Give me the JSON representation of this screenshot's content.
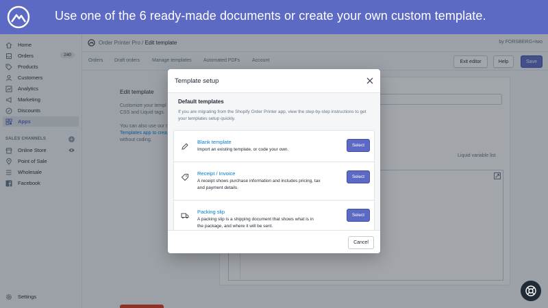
{
  "banner": {
    "text": "Use one of the 6 ready-made documents or create your own custom template.",
    "color": "#5c6ac4",
    "logo_icon": "mountain-logo"
  },
  "sidebar": {
    "items": [
      {
        "label": "Home",
        "icon": "home-icon"
      },
      {
        "label": "Orders",
        "icon": "orders-icon",
        "badge": "240"
      },
      {
        "label": "Products",
        "icon": "tag-icon"
      },
      {
        "label": "Customers",
        "icon": "person-icon"
      },
      {
        "label": "Analytics",
        "icon": "chart-icon"
      },
      {
        "label": "Marketing",
        "icon": "megaphone-icon"
      },
      {
        "label": "Discounts",
        "icon": "discount-icon"
      },
      {
        "label": "Apps",
        "icon": "apps-icon",
        "active": true
      }
    ],
    "channels_heading": "SALES CHANNELS",
    "channels": [
      {
        "label": "Online Store",
        "icon": "store-icon"
      },
      {
        "label": "Point of Sale",
        "icon": "pos-icon"
      },
      {
        "label": "Wholesale",
        "icon": "wholesale-icon"
      },
      {
        "label": "Facebook",
        "icon": "facebook-icon"
      }
    ],
    "settings_label": "Settings"
  },
  "topbar": {
    "app_name": "Order Printer Pro",
    "separator": "/",
    "current_page": "Edit template",
    "byline": "by FORSBERG+two"
  },
  "subnav": {
    "items": [
      "Orders",
      "Draft orders",
      "Manage templates",
      "Automated PDFs",
      "Account"
    ],
    "exit_editor": "Exit editor",
    "help": "Help",
    "save": "Save"
  },
  "main": {
    "title": "Edit template",
    "desc_lines": [
      "Customize your templ",
      "CSS and Liquid tags.",
      "You can also use our t",
      "Templates app to crea",
      "without coding."
    ],
    "liquid_label": "Liquid variable list"
  },
  "modal": {
    "title": "Template setup",
    "section_title": "Default templates",
    "section_desc": "If you are migrating from the Shopify Order Printer app, view the step-by-step instructions to get your templates setup quickly.",
    "templates": [
      {
        "name": "Blank template",
        "desc": "Import an existing template, or code your own.",
        "icon": "pencil-icon",
        "button": "Select"
      },
      {
        "name": "Receipt / Invoice",
        "desc": "A receipt shows purchase information and includes pricing, tax and payment details.",
        "icon": "tag-icon",
        "button": "Select"
      },
      {
        "name": "Packing slip",
        "desc": "A packing slip is a shipping document that shows what is in the package, and where it will be sent.",
        "icon": "truck-icon",
        "button": "Select"
      }
    ],
    "cancel": "Cancel"
  }
}
